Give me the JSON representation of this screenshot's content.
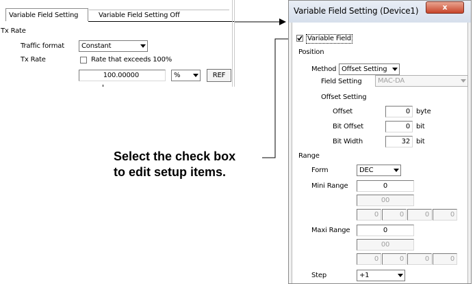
{
  "left_panel": {
    "tab_active": "Variable Field Setting",
    "tab_inactive": "Variable Field Setting Off",
    "tx_rate_label": "Tx Rate",
    "traffic_format_label": "Traffic format",
    "traffic_format_value": "Constant",
    "tx_rate_row_label": "Tx Rate",
    "rate_exceeds_label": "Rate that exceeds 100%",
    "rate_value": "100.00000",
    "unit_value": "%",
    "ref_button": "REF"
  },
  "callout": {
    "line1": "Select the check box",
    "line2": "to edit setup items."
  },
  "dialog": {
    "title": "Variable Field Setting (Device1)",
    "close_glyph": "x",
    "variable_field_label": "Variable Field",
    "variable_field_checked": true,
    "position_label": "Position",
    "method_label": "Method",
    "method_value": "Offset Setting",
    "field_setting_label": "Field Setting",
    "field_setting_value": "MAC-DA",
    "offset_setting_label": "Offset Setting",
    "offset_label": "Offset",
    "offset_value": "0",
    "offset_unit": "byte",
    "bit_offset_label": "Bit Offset",
    "bit_offset_value": "0",
    "bit_offset_unit": "bit",
    "bit_width_label": "Bit Width",
    "bit_width_value": "32",
    "bit_width_unit": "bit",
    "range_label": "Range",
    "form_label": "Form",
    "form_value": "DEC",
    "mini_range_label": "Mini Range",
    "mini_range_value": "0",
    "mini_hex_value": "00",
    "mini_bytes": [
      "0",
      "0",
      "0",
      "0"
    ],
    "maxi_range_label": "Maxi Range",
    "maxi_range_value": "0",
    "maxi_hex_value": "00",
    "maxi_bytes": [
      "0",
      "0",
      "0",
      "0"
    ],
    "step_label": "Step",
    "step_value": "+1"
  }
}
